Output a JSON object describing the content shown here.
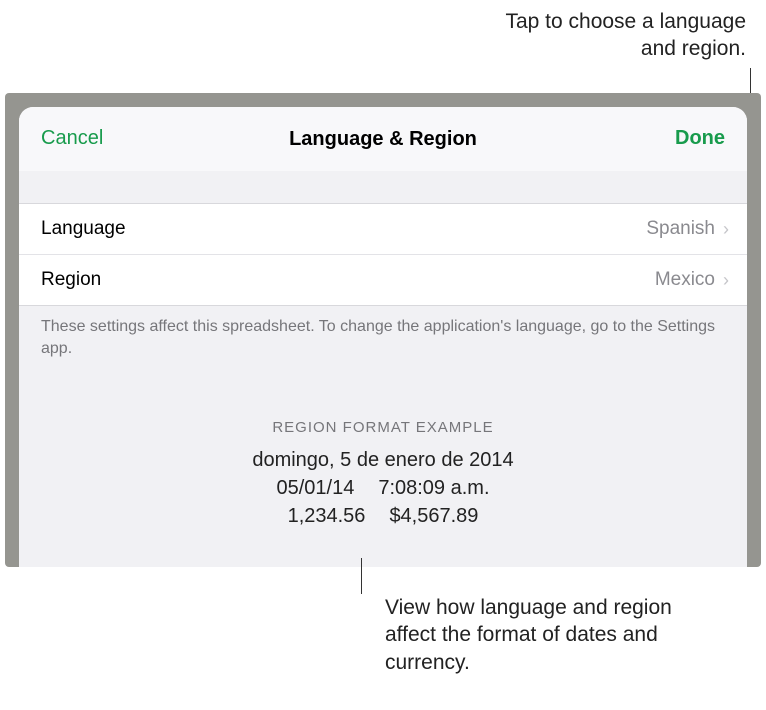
{
  "annotations": {
    "top": "Tap to choose a language and region.",
    "bottom": "View how language and region affect the format of dates and currency."
  },
  "header": {
    "cancel": "Cancel",
    "title": "Language & Region",
    "done": "Done"
  },
  "rows": {
    "language": {
      "label": "Language",
      "value": "Spanish"
    },
    "region": {
      "label": "Region",
      "value": "Mexico"
    }
  },
  "footnote": "These settings affect this spreadsheet. To change the application's language, go to the Settings app.",
  "example": {
    "heading": "REGION FORMAT EXAMPLE",
    "longDate": "domingo, 5 de enero de 2014",
    "shortDate": "05/01/14",
    "time": "7:08:09 a.m.",
    "number": "1,234.56",
    "currency": "$4,567.89"
  }
}
